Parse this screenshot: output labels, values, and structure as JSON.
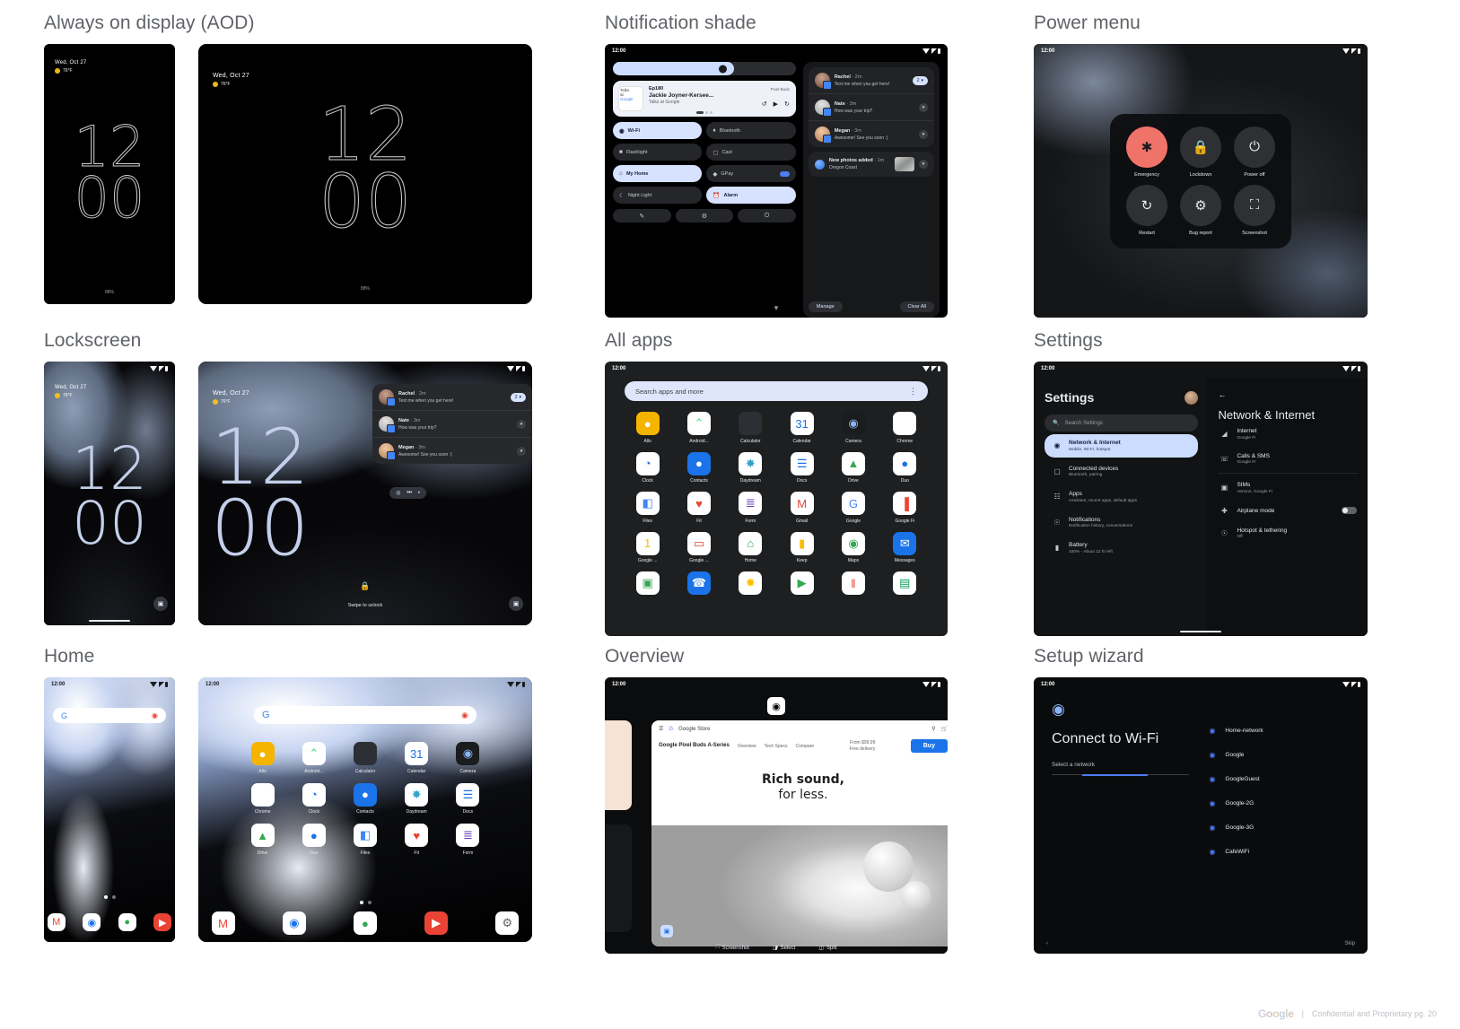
{
  "sections": {
    "aod": {
      "title": "Always on display (AOD)"
    },
    "notification_shade": {
      "title": "Notification shade"
    },
    "power_menu": {
      "title": "Power menu"
    },
    "lockscreen": {
      "title": "Lockscreen"
    },
    "all_apps": {
      "title": "All apps"
    },
    "settings": {
      "title": "Settings"
    },
    "home": {
      "title": "Home"
    },
    "overview": {
      "title": "Overview"
    },
    "setup_wizard": {
      "title": "Setup wizard"
    }
  },
  "status_bar": {
    "time": "12:00",
    "time_home_phone": "12:00"
  },
  "clock": {
    "hours": "12",
    "minutes": "00"
  },
  "ambient": {
    "date": "Wed, Oct 27",
    "temperature": "76°F",
    "battery": "88%"
  },
  "lockscreen": {
    "swipe_hint": "Swipe to unlock",
    "notifications": [
      {
        "name": "Rachel",
        "time": "2m",
        "body": "Text me when you get here!",
        "action": "2"
      },
      {
        "name": "Nate",
        "time": "3m",
        "body": "How was your trip?"
      },
      {
        "name": "Megan",
        "time": "3m",
        "body": "Awesome! See you soon :)"
      }
    ]
  },
  "shade": {
    "brightness_label": "Brightness",
    "media": {
      "episode": "Ep180",
      "title": "Jackie Joyner-Kersee...",
      "source": "Talks at Google",
      "badge": "Pixel Buds",
      "art_line1": "Talks",
      "art_line2": "at",
      "art_line3": "Google"
    },
    "tiles": [
      {
        "label": "Wi-Fi",
        "icon": "wifi-icon",
        "on": true
      },
      {
        "label": "Bluetooth",
        "icon": "bluetooth-icon",
        "on": false
      },
      {
        "label": "Flashlight",
        "icon": "flashlight-icon",
        "on": false
      },
      {
        "label": "Cast",
        "icon": "cast-icon",
        "on": false
      },
      {
        "label": "My Home",
        "icon": "home-icon",
        "on": true
      },
      {
        "label": "GPay",
        "icon": "gpay-icon",
        "on": false
      },
      {
        "label": "Night Light",
        "icon": "moon-icon",
        "on": false
      },
      {
        "label": "Alarm",
        "icon": "alarm-icon",
        "on": true
      }
    ],
    "footer_icons": [
      "edit-icon",
      "settings-gear-icon",
      "power-icon"
    ],
    "notifications": [
      {
        "name": "Rachel",
        "time": "2m",
        "body": "Text me when you get here!",
        "action": "2"
      },
      {
        "name": "Nate",
        "time": "3m",
        "body": "How was your trip?"
      },
      {
        "name": "Megan",
        "time": "3m",
        "body": "Awesome! See you soon :)"
      }
    ],
    "photo_notification": {
      "title": "New photos added",
      "time": "1m",
      "body": "Oregon Coast"
    },
    "manage_label": "Manage",
    "clear_all_label": "Clear All"
  },
  "power_menu": {
    "items": [
      {
        "label": "Emergency",
        "icon": "emergency-icon"
      },
      {
        "label": "Lockdown",
        "icon": "lock-icon"
      },
      {
        "label": "Power off",
        "icon": "power-icon"
      },
      {
        "label": "Restart",
        "icon": "restart-icon"
      },
      {
        "label": "Bug report",
        "icon": "bug-icon"
      },
      {
        "label": "Screenshot",
        "icon": "screenshot-icon"
      }
    ]
  },
  "all_apps": {
    "search_placeholder": "Search apps and more",
    "apps": [
      {
        "label": "Allo",
        "glyph": "●",
        "bg": "#f5b400",
        "fg": "#fff",
        "shape": "allo"
      },
      {
        "label": "Android...",
        "glyph": "⌃",
        "bg": "#ffffff",
        "fg": "#3ddc84",
        "shape": "android"
      },
      {
        "label": "Calculator",
        "glyph": "",
        "bg": "#2c2f33",
        "fg": "#8ab4f8",
        "shape": "calc"
      },
      {
        "label": "Calendar",
        "glyph": "31",
        "bg": "#ffffff",
        "fg": "#1a73e8",
        "shape": "cal"
      },
      {
        "label": "Camera",
        "glyph": "◉",
        "bg": "#1a1c1e",
        "fg": "#8ab4f8",
        "shape": "cam"
      },
      {
        "label": "Chrome",
        "glyph": "",
        "bg": "#ffffff",
        "fg": "#1a73e8",
        "shape": "chrome"
      },
      {
        "label": "Clock",
        "glyph": "◔",
        "bg": "#ffffff",
        "fg": "#1a73e8",
        "shape": "clock"
      },
      {
        "label": "Contacts",
        "glyph": "●",
        "bg": "#1a73e8",
        "fg": "#ffffff",
        "shape": "contacts"
      },
      {
        "label": "Daydream",
        "glyph": "✸",
        "bg": "#ffffff",
        "fg": "#34a4c6",
        "shape": "daydream"
      },
      {
        "label": "Docs",
        "glyph": "☰",
        "bg": "#ffffff",
        "fg": "#1a73e8",
        "shape": "docs"
      },
      {
        "label": "Drive",
        "glyph": "▲",
        "bg": "#ffffff",
        "fg": "#34a853",
        "shape": "drive"
      },
      {
        "label": "Duo",
        "glyph": "●",
        "bg": "#ffffff",
        "fg": "#1a73e8",
        "shape": "duo"
      },
      {
        "label": "Files",
        "glyph": "◧",
        "bg": "#ffffff",
        "fg": "#4285f4",
        "shape": "files"
      },
      {
        "label": "Fit",
        "glyph": "♥",
        "bg": "#ffffff",
        "fg": "#ea4335",
        "shape": "fit"
      },
      {
        "label": "Form",
        "glyph": "≣",
        "bg": "#ffffff",
        "fg": "#673ab7",
        "shape": "form"
      },
      {
        "label": "Gmail",
        "glyph": "M",
        "bg": "#ffffff",
        "fg": "#ea4335",
        "shape": "gmail"
      },
      {
        "label": "Google",
        "glyph": "G",
        "bg": "#ffffff",
        "fg": "#4285f4",
        "shape": "google"
      },
      {
        "label": "Google Fi",
        "glyph": "▐",
        "bg": "#ffffff",
        "fg": "#ea4335",
        "shape": "fi"
      },
      {
        "label": "Google ...",
        "glyph": "1",
        "bg": "#ffffff",
        "fg": "#fbbc04",
        "shape": "one"
      },
      {
        "label": "Google ...",
        "glyph": "▭",
        "bg": "#ffffff",
        "fg": "#ea4335",
        "shape": "pay"
      },
      {
        "label": "Home",
        "glyph": "⌂",
        "bg": "#ffffff",
        "fg": "#34a853",
        "shape": "ghome"
      },
      {
        "label": "Keep",
        "glyph": "▮",
        "bg": "#ffffff",
        "fg": "#fbbc04",
        "shape": "keep"
      },
      {
        "label": "Maps",
        "glyph": "◉",
        "bg": "#ffffff",
        "fg": "#34a853",
        "shape": "maps"
      },
      {
        "label": "Messages",
        "glyph": "✉",
        "bg": "#1a73e8",
        "fg": "#ffffff",
        "shape": "msg"
      },
      {
        "label": "",
        "glyph": "▣",
        "bg": "#ffffff",
        "fg": "#34a853",
        "shape": "photos2"
      },
      {
        "label": "",
        "glyph": "☎",
        "bg": "#1a73e8",
        "fg": "#ffffff",
        "shape": "phone"
      },
      {
        "label": "",
        "glyph": "✸",
        "bg": "#ffffff",
        "fg": "#fbbc04",
        "shape": "photos"
      },
      {
        "label": "",
        "glyph": "▶",
        "bg": "#ffffff",
        "fg": "#34a853",
        "shape": "play"
      },
      {
        "label": "",
        "glyph": "‖",
        "bg": "#ffffff",
        "fg": "#ea4335",
        "shape": "assistant"
      },
      {
        "label": "",
        "glyph": "▤",
        "bg": "#ffffff",
        "fg": "#0f9d58",
        "shape": "sheets"
      }
    ]
  },
  "settings": {
    "title": "Settings",
    "search_placeholder": "Search Settings",
    "menu": [
      {
        "label": "Network & Internet",
        "sub": "Mobile, Wi-Fi, hotspot",
        "icon": "wifi-icon",
        "active": true
      },
      {
        "label": "Connected devices",
        "sub": "Bluetooth, pairing",
        "icon": "devices-icon",
        "active": false
      },
      {
        "label": "Apps",
        "sub": "Assistant, recent apps, default apps",
        "icon": "apps-icon",
        "active": false
      },
      {
        "label": "Notifications",
        "sub": "Notification history, conversations",
        "icon": "bell-icon",
        "active": false
      },
      {
        "label": "Battery",
        "sub": "100% - About 12 hr left",
        "icon": "battery-icon",
        "active": false
      }
    ],
    "detail_title": "Network & Internet",
    "detail_rows": [
      {
        "label": "Internet",
        "sub": "Google Fi",
        "icon": "signal-icon",
        "toggle": false
      },
      {
        "label": "Calls & SMS",
        "sub": "Google Fi",
        "icon": "phone-icon",
        "toggle": false
      },
      {
        "label": "SIMs",
        "sub": "Verizon, Google Fi",
        "icon": "sim-icon",
        "toggle": false
      },
      {
        "label": "Airplane mode",
        "sub": "",
        "icon": "airplane-icon",
        "toggle": true
      },
      {
        "label": "Hotspot & tethering",
        "sub": "Off",
        "icon": "hotspot-icon",
        "toggle": false
      }
    ]
  },
  "home": {
    "search_placeholder": "",
    "apps_tablet": [
      "Allo",
      "Android...",
      "Calculator",
      "Calendar",
      "Camera",
      "Chrome",
      "Clock",
      "Contacts",
      "Daydream",
      "Docs",
      "Drive",
      "Duo",
      "Files",
      "Fit",
      "Form"
    ],
    "dock": [
      "Gmail",
      "Chrome",
      "Maps",
      "YouTube",
      "Settings"
    ],
    "dock_phone": [
      "Gmail",
      "Chrome",
      "Maps",
      "YouTube"
    ]
  },
  "overview": {
    "app_name": "Chrome",
    "site": "Google Store",
    "product": "Google Pixel Buds A-Series",
    "nav": [
      "Overview",
      "Tech Specs",
      "Compare"
    ],
    "price": "From $99.99",
    "shipping": "Free delivery",
    "buy_label": "Buy",
    "hero_line1": "Rich sound,",
    "hero_line2": "for less.",
    "toolbar": [
      {
        "label": "Screenshot",
        "icon": "screenshot-icon"
      },
      {
        "label": "Select",
        "icon": "select-icon"
      },
      {
        "label": "Split",
        "icon": "split-icon"
      }
    ]
  },
  "setup_wizard": {
    "title": "Connect to Wi-Fi",
    "label": "Select a network",
    "networks": [
      "Home-network",
      "Google",
      "GoogleGuest",
      "Google-2G",
      "Google-3G",
      "CafeWiFi"
    ],
    "back_label": "‹",
    "skip_label": "Skip"
  },
  "footer": {
    "brand": "Google",
    "separator": "|",
    "text": "Confidential and Proprietary  pg. 20"
  },
  "colors": {
    "accent_blue": "#4285f4",
    "emergency_red": "#f0736a",
    "light_blue_pill": "#ccdcff",
    "title_gray": "#5f6368"
  }
}
